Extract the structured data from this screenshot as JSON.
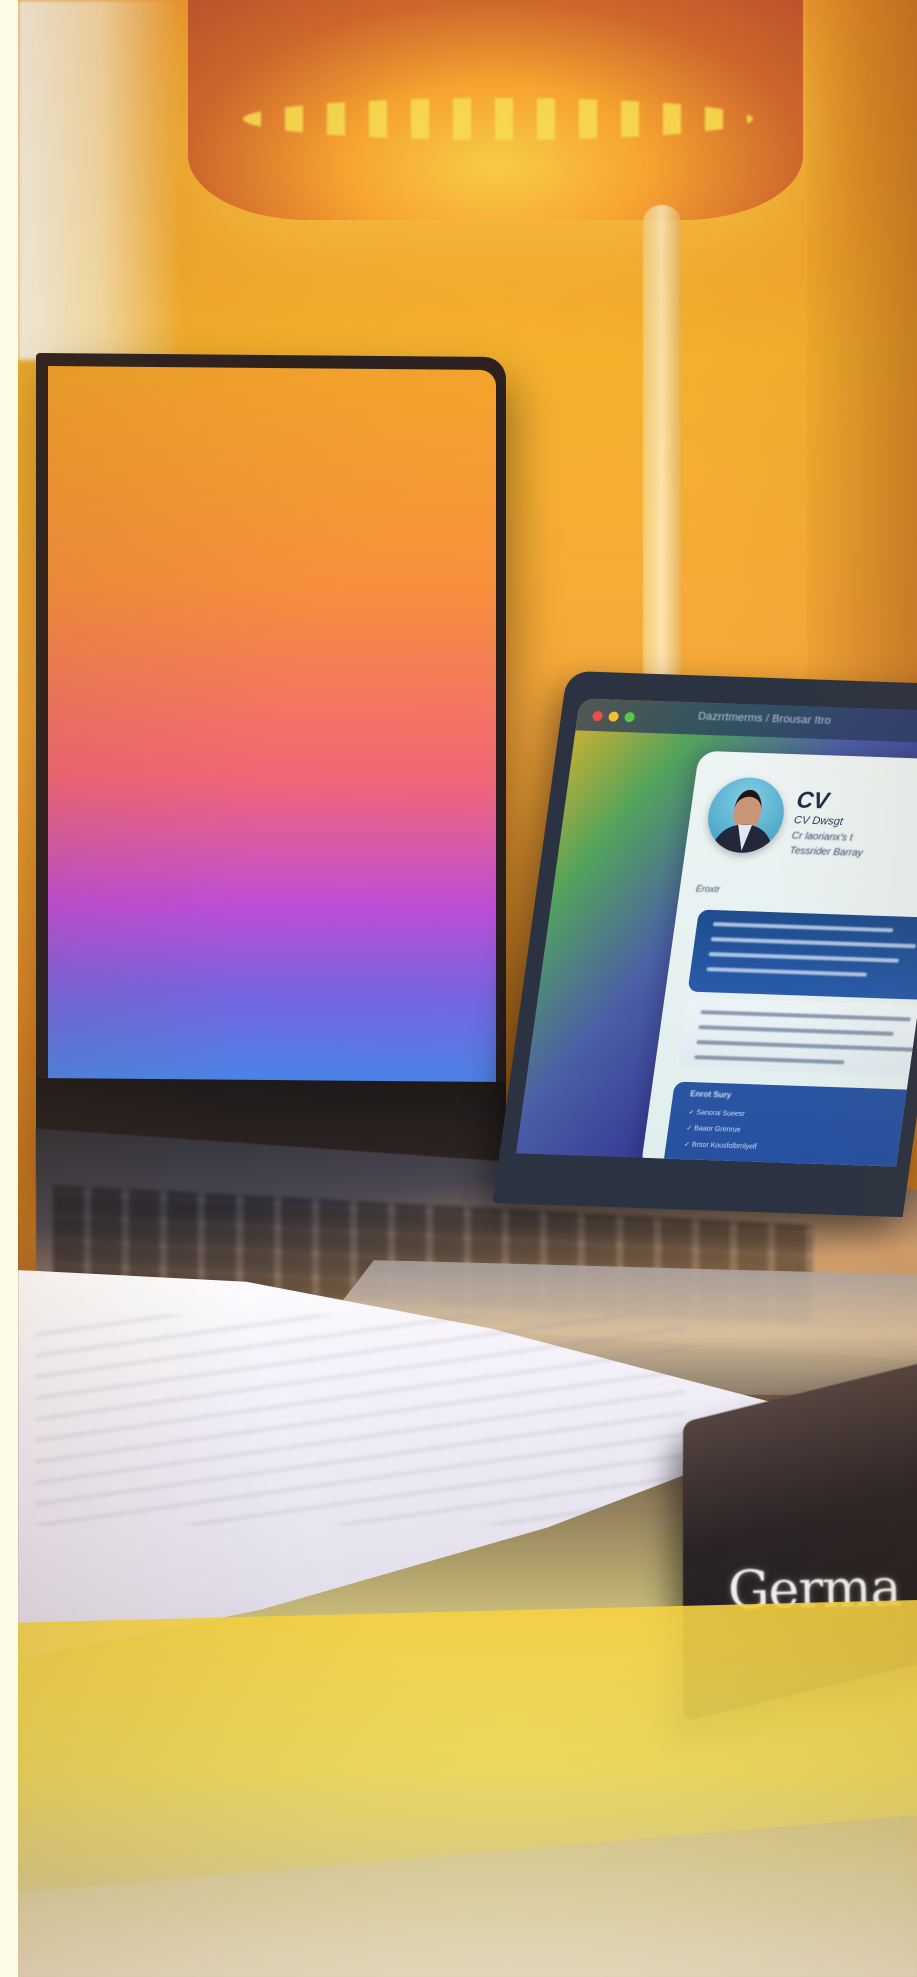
{
  "scene": {
    "cv_title": "CV",
    "cv_subtitle": "CV Dwsgt",
    "cv_text_lines": [
      "Cr laorianx's t",
      "Tessrider Barray"
    ],
    "cv_section_label": "Eroxtr",
    "breadcrumb": "Dazrrtmerms  /  Brousar  Itro",
    "book_label": "Germa"
  },
  "colors": {
    "warm_light": "#f7b42d",
    "tablet_gradient_top": "#f5a52b",
    "tablet_gradient_middle": "#bd4ed7",
    "tablet_gradient_bottom": "#2ea3e7",
    "cv_blue": "#1f4c8d"
  },
  "icons": [
    "close-dot-icon",
    "minimize-dot-icon",
    "maximize-dot-icon",
    "person-avatar-icon"
  ]
}
